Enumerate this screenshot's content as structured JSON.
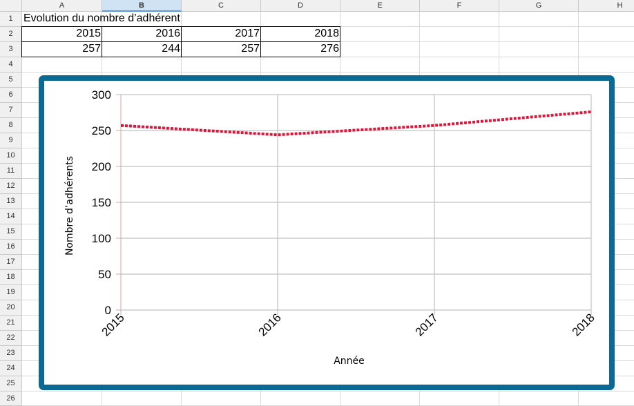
{
  "spreadsheet": {
    "columns": [
      "A",
      "B",
      "C",
      "D",
      "E",
      "F",
      "G",
      "H"
    ],
    "selected_column": "B",
    "rows": [
      "1",
      "2",
      "3",
      "4",
      "5",
      "6",
      "7",
      "8",
      "9",
      "10",
      "11",
      "12",
      "13",
      "14",
      "15",
      "16",
      "17",
      "18",
      "19",
      "20",
      "21",
      "22",
      "23",
      "24",
      "25",
      "26"
    ],
    "title_cell": "Evolution du nombre d’adhérent",
    "years": [
      "2015",
      "2016",
      "2017",
      "2018"
    ],
    "counts": [
      "257",
      "244",
      "257",
      "276"
    ]
  },
  "chart_data": {
    "type": "line",
    "categories": [
      "2015",
      "2016",
      "2017",
      "2018"
    ],
    "series": [
      {
        "values": [
          257,
          244,
          257,
          276
        ],
        "color": "#e0153a",
        "dash": "dotted"
      }
    ],
    "xlabel": "Année",
    "ylabel": "Nombre d’adhérents",
    "ylim": [
      0,
      300
    ],
    "yticks": [
      0,
      50,
      100,
      150,
      200,
      250,
      300
    ],
    "grid": true,
    "frame_color": "#0a6a94"
  }
}
